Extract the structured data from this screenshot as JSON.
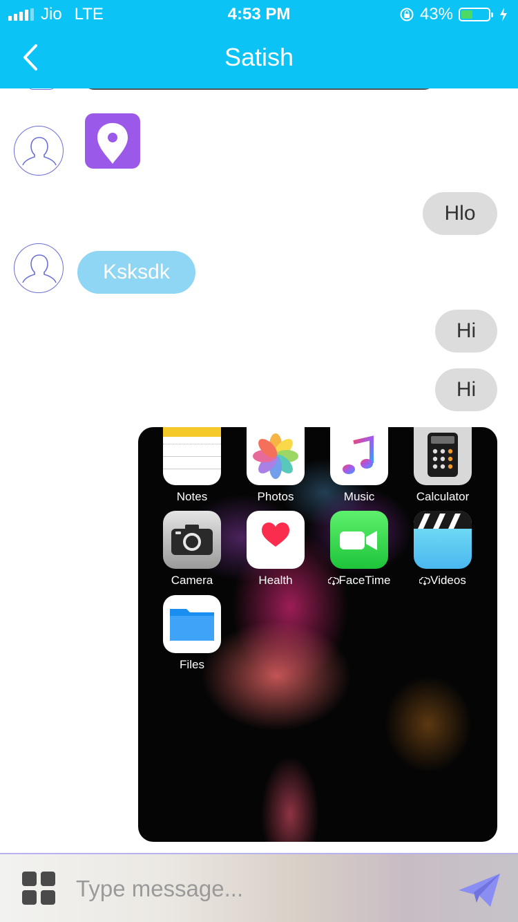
{
  "status_bar": {
    "carrier": "Jio",
    "network": "LTE",
    "time": "4:53 PM",
    "battery": "43%",
    "battery_level": 0.43
  },
  "header": {
    "title": "Satish"
  },
  "messages": [
    {
      "type": "location",
      "direction": "incoming"
    },
    {
      "type": "text",
      "direction": "outgoing",
      "text": "Hlo"
    },
    {
      "type": "text",
      "direction": "incoming",
      "text": "Ksksdk"
    },
    {
      "type": "text",
      "direction": "outgoing",
      "text": "Hi"
    },
    {
      "type": "text",
      "direction": "outgoing",
      "text": "Hi"
    },
    {
      "type": "image",
      "direction": "outgoing"
    }
  ],
  "shared_screenshot": {
    "apps": [
      {
        "label": "Notes",
        "icon": "notes-icon"
      },
      {
        "label": "Photos",
        "icon": "photos-icon"
      },
      {
        "label": "Music",
        "icon": "music-icon"
      },
      {
        "label": "Calculator",
        "icon": "calculator-icon"
      },
      {
        "label": "Camera",
        "icon": "camera-icon"
      },
      {
        "label": "Health",
        "icon": "health-icon"
      },
      {
        "label": "FaceTime",
        "icon": "facetime-icon"
      },
      {
        "label": "Videos",
        "icon": "videos-icon"
      },
      {
        "label": "Files",
        "icon": "files-icon"
      }
    ]
  },
  "composer": {
    "placeholder": "Type message..."
  },
  "colors": {
    "accent": "#0bc4f5",
    "incoming_bubble": "#8ed6f3",
    "outgoing_bubble": "#dcdcdc",
    "location_tile": "#9b59e9",
    "send_icon": "#8a8ef2"
  }
}
